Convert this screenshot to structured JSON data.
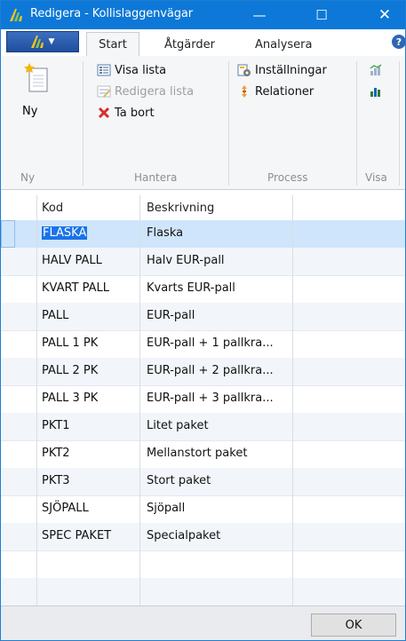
{
  "window": {
    "title": "Redigera - Kollislaggenvägar",
    "minimize_glyph": "—",
    "maximize_glyph": "☐",
    "close_glyph": "✕"
  },
  "tabs": [
    {
      "label": "Start",
      "active": true
    },
    {
      "label": "Åtgärder",
      "active": false
    },
    {
      "label": "Analysera",
      "active": false
    }
  ],
  "help": {
    "glyph": "?"
  },
  "ribbon": {
    "groups": {
      "ny": "Ny",
      "hantera": "Hantera",
      "process": "Process",
      "visa": "Visa"
    },
    "new_button": "Ny",
    "visa_lista": "Visa lista",
    "redigera_lista": "Redigera lista",
    "ta_bort": "Ta bort",
    "installningar": "Inställningar",
    "relationer": "Relationer"
  },
  "grid": {
    "columns": [
      "Kod",
      "Beskrivning"
    ],
    "rows": [
      {
        "kod": "FLASKA",
        "beskrivning": "Flaska"
      },
      {
        "kod": "HALV PALL",
        "beskrivning": "Halv EUR-pall"
      },
      {
        "kod": "KVART PALL",
        "beskrivning": "Kvarts EUR-pall"
      },
      {
        "kod": "PALL",
        "beskrivning": "EUR-pall"
      },
      {
        "kod": "PALL 1 PK",
        "beskrivning": "EUR-pall + 1 pallkra..."
      },
      {
        "kod": "PALL 2 PK",
        "beskrivning": "EUR-pall + 2 pallkra..."
      },
      {
        "kod": "PALL 3 PK",
        "beskrivning": "EUR-pall + 3 pallkra..."
      },
      {
        "kod": "PKT1",
        "beskrivning": "Litet paket"
      },
      {
        "kod": "PKT2",
        "beskrivning": "Mellanstort paket"
      },
      {
        "kod": "PKT3",
        "beskrivning": "Stort paket"
      },
      {
        "kod": "SJÖPALL",
        "beskrivning": "Sjöpall"
      },
      {
        "kod": "SPEC PAKET",
        "beskrivning": "Specialpaket"
      }
    ],
    "selected_row": 0
  },
  "footer": {
    "ok": "OK"
  },
  "colors": {
    "titlebar": "#0d78d7",
    "selection": "#1a73e8",
    "selected_row": "#cfe5fb",
    "alt_row": "#f2f6fb",
    "delete_icon": "#d32f2f"
  }
}
